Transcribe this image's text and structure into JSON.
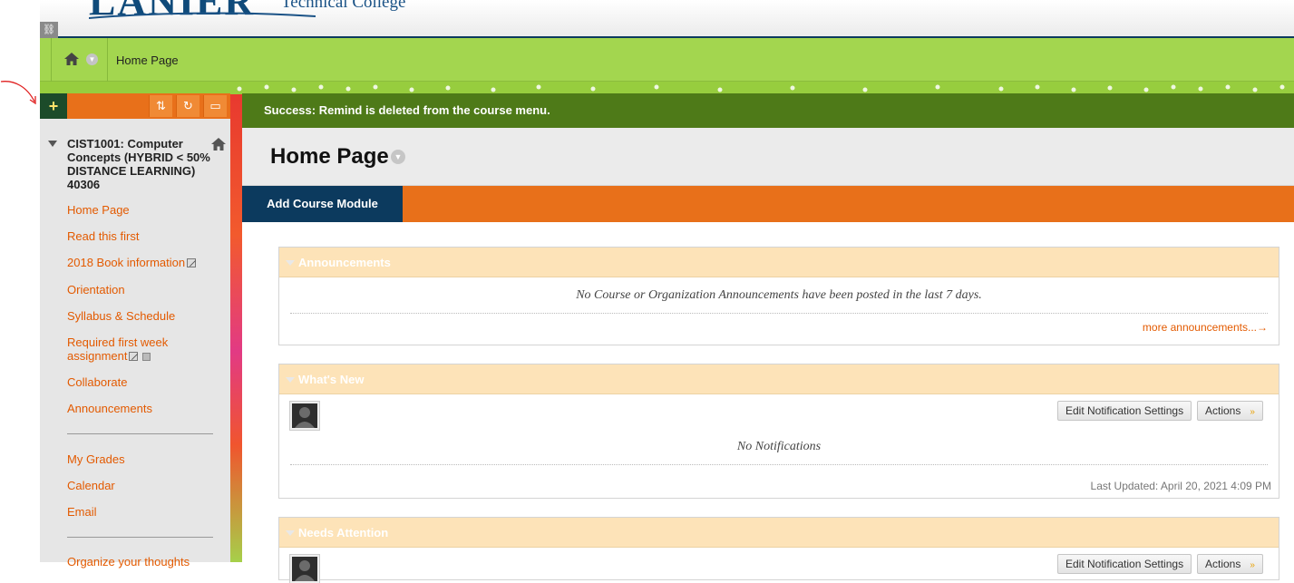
{
  "banner": {
    "logo_text": "LANIER",
    "logo_sub": "Technical College"
  },
  "breadcrumb": {
    "current": "Home Page"
  },
  "course_menu": {
    "add_label": "+",
    "course_title": "CIST1001: Computer Concepts (HYBRID < 50% DISTANCE LEARNING) 40306",
    "items": [
      {
        "label": "Home Page"
      },
      {
        "label": "Read this first"
      },
      {
        "label": "2018 Book information"
      },
      {
        "label": "Orientation"
      },
      {
        "label": "Syllabus & Schedule"
      },
      {
        "label": "Required first week assignment"
      },
      {
        "label": "Collaborate"
      },
      {
        "label": "Announcements"
      },
      {
        "label": "My Grades"
      },
      {
        "label": "Calendar"
      },
      {
        "label": "Email"
      },
      {
        "label": "Organize your thoughts"
      }
    ]
  },
  "content": {
    "success_message": "Success: Remind is deleted from the course menu.",
    "page_title": "Home Page",
    "add_module_label": "Add Course Module",
    "announcements": {
      "title": "Announcements",
      "empty_text": "No Course or Organization Announcements have been posted in the last 7 days.",
      "more_link": "more announcements...→"
    },
    "whats_new": {
      "title": "What's New",
      "edit_btn": "Edit Notification Settings",
      "actions_btn": "Actions",
      "actions_caret": "»",
      "empty_text": "No Notifications",
      "updated": "Last Updated: April 20, 2021 4:09 PM"
    },
    "needs_attention": {
      "title": "Needs Attention",
      "edit_btn": "Edit Notification Settings",
      "actions_btn": "Actions",
      "actions_caret": "»"
    }
  },
  "colors": {
    "accent_orange": "#e8701a",
    "success_green": "#4e7a18",
    "nav_navy": "#0c3a5e",
    "crumb_green": "#a3d64f",
    "module_header": "#fde3b8"
  }
}
